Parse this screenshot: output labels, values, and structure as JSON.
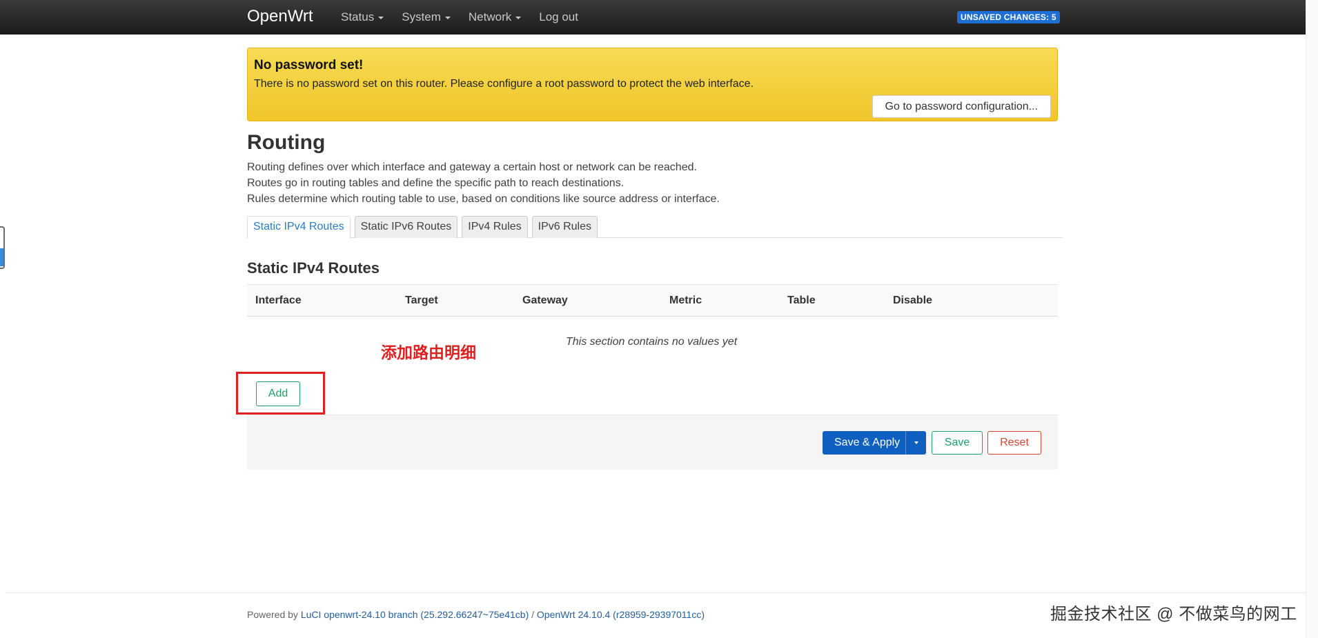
{
  "header": {
    "brand": "OpenWrt",
    "nav": [
      {
        "label": "Status",
        "dropdown": true
      },
      {
        "label": "System",
        "dropdown": true
      },
      {
        "label": "Network",
        "dropdown": true
      },
      {
        "label": "Log out",
        "dropdown": false
      }
    ],
    "unsaved_badge": "UNSAVED CHANGES: 5"
  },
  "alert": {
    "title": "No password set!",
    "text": "There is no password set on this router. Please configure a root password to protect the web interface.",
    "button": "Go to password configuration..."
  },
  "page": {
    "title": "Routing",
    "description": [
      "Routing defines over which interface and gateway a certain host or network can be reached.",
      "Routes go in routing tables and define the specific path to reach destinations.",
      "Rules determine which routing table to use, based on conditions like source address or interface."
    ]
  },
  "tabs": [
    "Static IPv4 Routes",
    "Static IPv6 Routes",
    "IPv4 Rules",
    "IPv6 Rules"
  ],
  "section": {
    "title": "Static IPv4 Routes",
    "columns": [
      "Interface",
      "Target",
      "Gateway",
      "Metric",
      "Table",
      "Disable"
    ],
    "empty_text": "This section contains no values yet",
    "add_label": "Add"
  },
  "annotation": "添加路由明细",
  "actions": {
    "save_apply": "Save & Apply",
    "save": "Save",
    "reset": "Reset"
  },
  "footer": {
    "prefix": "Powered by ",
    "luci": "LuCI openwrt-24.10 branch (25.292.66247~75e41cb)",
    "separator": " / ",
    "openwrt": "OpenWrt 24.10.4 (r28959-29397011cc)"
  },
  "watermark": "掘金技术社区 @ 不做菜鸟的网工",
  "colors": {
    "primary": "#0f5fc0",
    "positive": "#1ea06b",
    "negative": "#d9442e",
    "warning": "#f0c52a",
    "annotation": "#e02020"
  }
}
